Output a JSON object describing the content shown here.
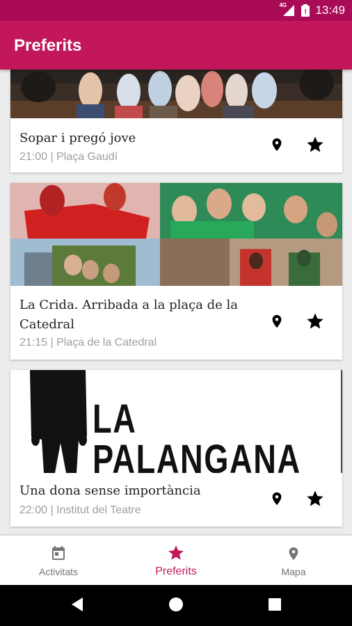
{
  "status_bar": {
    "network": "4G",
    "time": "13:49",
    "icons": [
      "signal-icon",
      "battery-icon"
    ]
  },
  "app_bar": {
    "title": "Preferits"
  },
  "colors": {
    "primary": "#c2185b",
    "primary_dark": "#a90b56",
    "accent": "#c2185b"
  },
  "events": [
    {
      "title": "Sopar i pregó jove",
      "time": "21:00",
      "place": "Plaça Gaudí",
      "subtitle": "21:00 | Plaça Gaudí",
      "icons": [
        "location-pin-icon",
        "star-icon"
      ]
    },
    {
      "title": "La Crida. Arribada a la plaça de la Catedral",
      "time": "21:15",
      "place": "Plaça de la Catedral",
      "subtitle": "21:15 | Plaça de la Catedral",
      "icons": [
        "location-pin-icon",
        "star-icon"
      ]
    },
    {
      "title": "Una dona sense importància",
      "time": "22:00",
      "place": "Institut del Teatre",
      "subtitle": "22:00 | Institut del Teatre",
      "poster_text": "LA PALANGANA",
      "icons": [
        "location-pin-icon",
        "star-icon"
      ]
    }
  ],
  "bottom_nav": {
    "tabs": [
      {
        "label": "Activitats",
        "icon": "calendar-icon",
        "active": false
      },
      {
        "label": "Preferits",
        "icon": "star-icon",
        "active": true
      },
      {
        "label": "Mapa",
        "icon": "location-pin-icon",
        "active": false
      }
    ]
  },
  "system_nav": {
    "buttons": [
      "back-icon",
      "home-icon",
      "recents-icon"
    ]
  }
}
